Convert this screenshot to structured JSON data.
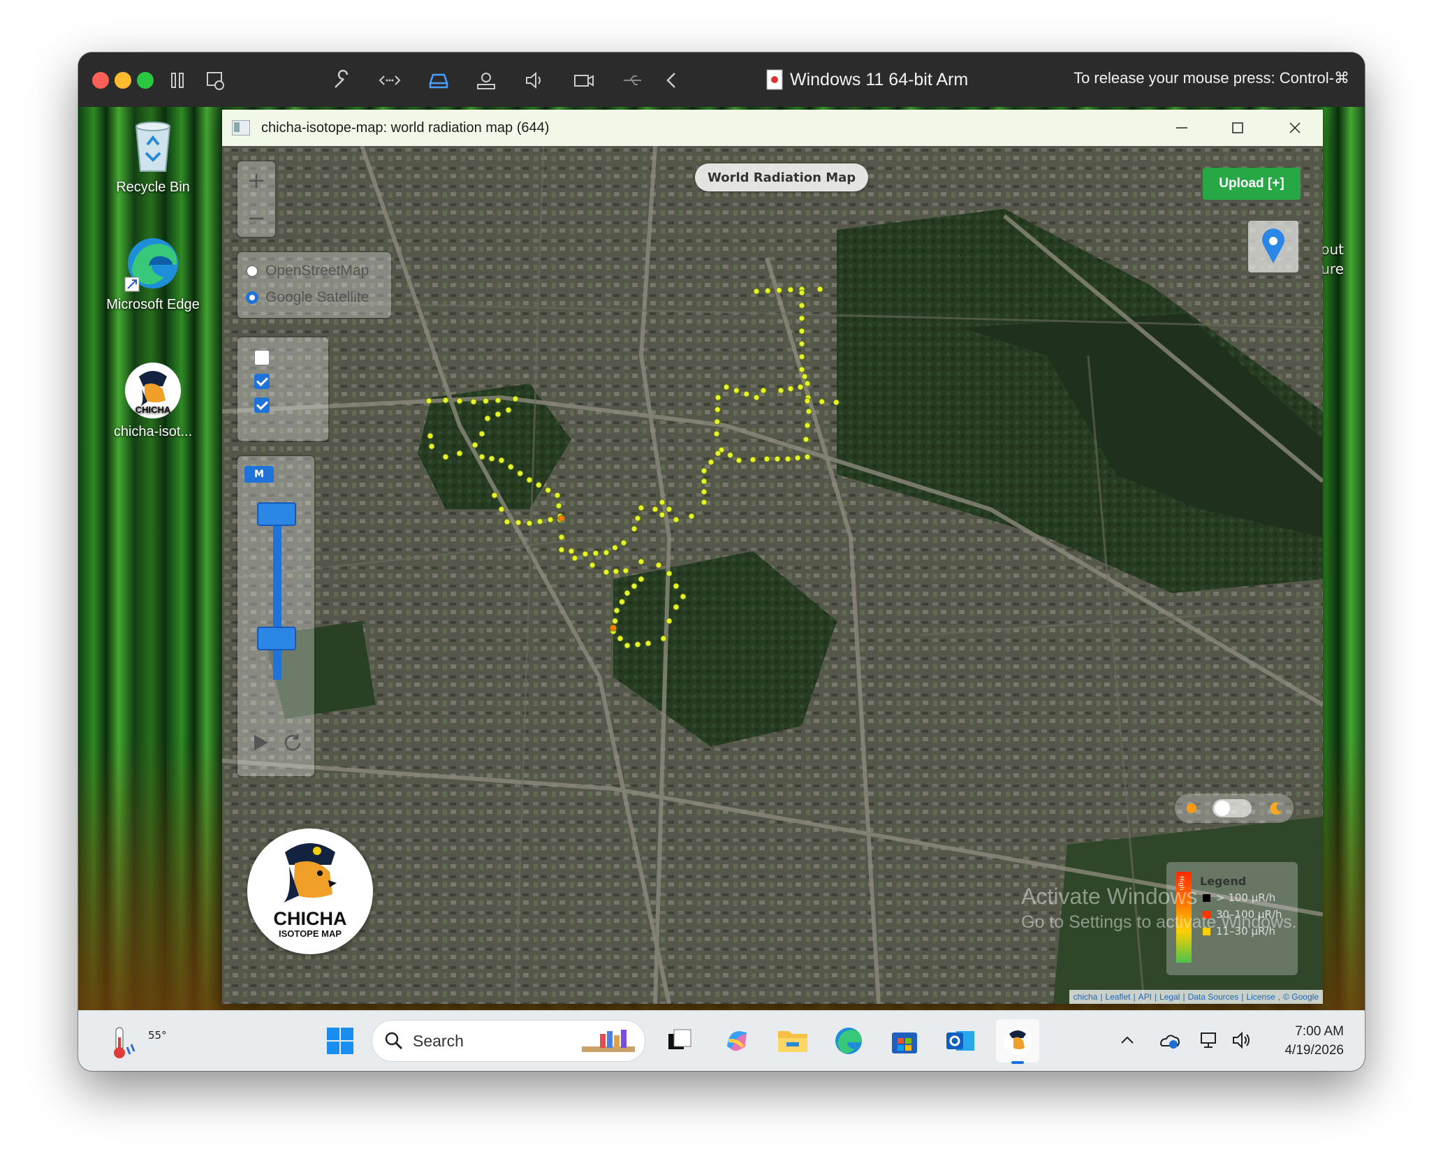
{
  "vm_bar": {
    "title": "Windows 11 64-bit Arm",
    "release_hint": "To release your mouse press: Control-⌘",
    "icons": [
      "pause-icon",
      "snapshot-icon",
      "wrench-icon",
      "code-arrows-icon",
      "drive-icon",
      "user-camera-icon",
      "speaker-icon",
      "video-camera-icon",
      "usb-icon",
      "chevron-left-icon"
    ]
  },
  "desktop": {
    "icons": [
      {
        "label": "Recycle Bin",
        "icon": "recycle-bin-icon"
      },
      {
        "label": "Microsoft Edge",
        "icon": "edge-icon"
      },
      {
        "label": "chicha-isot...",
        "icon": "chicha-icon"
      }
    ],
    "peek_text_1": "out",
    "peek_text_2": "ure"
  },
  "window": {
    "title": "chicha-isotope-map: world radiation map (644)",
    "controls": [
      "minimize-icon",
      "maximize-icon",
      "close-icon"
    ]
  },
  "map": {
    "header_chip": "World Radiation Map",
    "upload_label": "Upload [+]",
    "zoom_in": "+",
    "zoom_out": "−",
    "layers": [
      {
        "label": "OpenStreetMap",
        "selected": false
      },
      {
        "label": "Google Satellite",
        "selected": true
      }
    ],
    "overlay_toggles": [
      false,
      true,
      true
    ],
    "timeline_badge": "M",
    "theme_icons": [
      "sun-icon",
      "moon-icon"
    ],
    "legend": {
      "axis_label": "High",
      "title": "Legend",
      "rows": [
        {
          "text": "> 100 μR/h",
          "color": "#000000"
        },
        {
          "text": "30–100 μR/h",
          "color": "#ff3300"
        },
        {
          "text": "11–30 μR/h",
          "color": "#ffd000"
        }
      ]
    },
    "activation": {
      "line1": "Activate Windows",
      "line2": "Go to Settings to activate Windows."
    },
    "attribution": [
      "chicha",
      "Leaflet",
      "API",
      "Legal",
      "Data Sources",
      "License",
      "© Google"
    ],
    "logo": {
      "line1": "CHICHA",
      "line2": "ISOTOPE MAP"
    },
    "marker_colors": {
      "normal": "#e6f52a",
      "elevated": "#ff7a00"
    }
  },
  "taskbar": {
    "weather_temp": "55°",
    "search_placeholder": "Search",
    "apps": [
      "windows-start-icon",
      "task-view-icon",
      "copilot-icon",
      "file-explorer-icon",
      "edge-icon",
      "store-icon",
      "outlook-icon",
      "chicha-icon"
    ],
    "time": "7:00 AM",
    "date": "4/19/2026"
  }
}
